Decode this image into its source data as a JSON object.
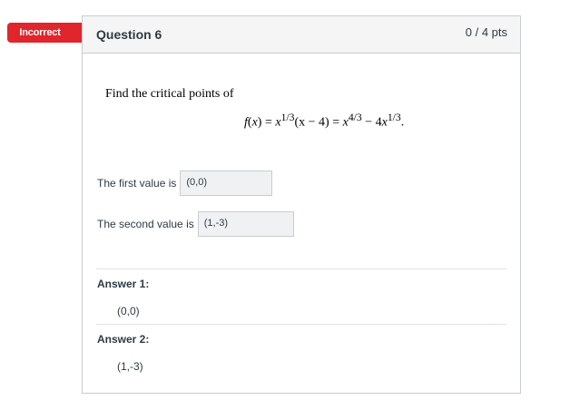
{
  "status_badge": "Incorrect",
  "question": {
    "title": "Question 6",
    "points": "0 / 4 pts",
    "prompt": "Find the critical points of",
    "formula": {
      "f": "f",
      "x": "x",
      "exp_third": "1/3",
      "paren": "(x − 4) = ",
      "exp_four_thirds": "4/3",
      "minus_term": " − 4",
      "end": "."
    }
  },
  "responses": [
    {
      "label": "The first value is",
      "value": "(0,0)"
    },
    {
      "label": "The second value is",
      "value": "(1,-3)"
    }
  ],
  "answers": [
    {
      "label": "Answer 1:",
      "value": "(0,0)"
    },
    {
      "label": "Answer 2:",
      "value": "(1,-3)"
    }
  ]
}
